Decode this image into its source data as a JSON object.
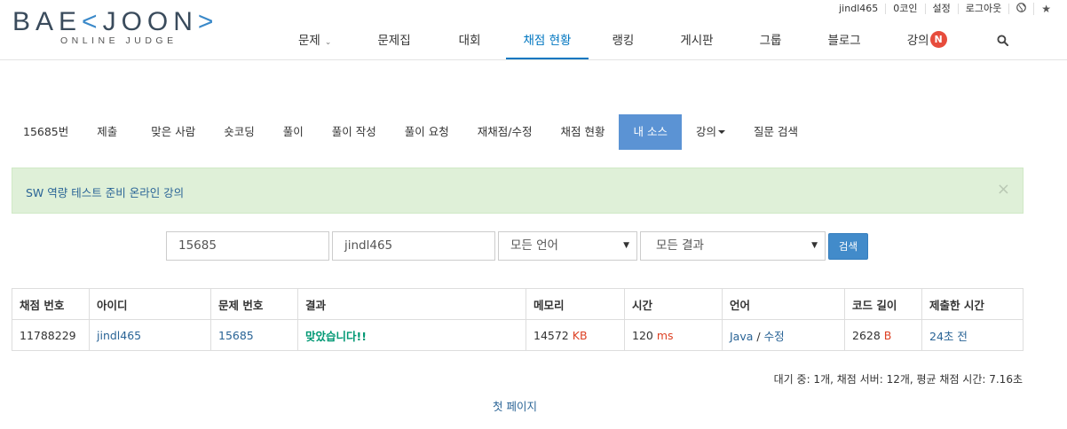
{
  "logo": {
    "sub": "ONLINE JUDGE"
  },
  "topbar": {
    "user": "jindl465",
    "coins": "0코인",
    "settings": "설정",
    "logout": "로그아웃"
  },
  "nav": {
    "items": [
      "문제",
      "문제집",
      "대회",
      "채점 현황",
      "랭킹",
      "게시판",
      "그룹",
      "블로그",
      "강의"
    ],
    "badge": "N"
  },
  "subnav": {
    "items": [
      "15685번",
      "제출",
      "맞은 사람",
      "숏코딩",
      "풀이",
      "풀이 작성",
      "풀이 요청",
      "재채점/수정",
      "채점 현황",
      "내 소스",
      "강의",
      "질문 검색"
    ]
  },
  "alert": {
    "text": "SW 역량 테스트 준비 온라인 강의",
    "close": "×"
  },
  "search": {
    "problem": "15685",
    "user": "jindl465",
    "language": "모든 언어",
    "result": "모든 결과",
    "button": "검색"
  },
  "table": {
    "headers": [
      "채점 번호",
      "아이디",
      "문제 번호",
      "결과",
      "메모리",
      "시간",
      "언어",
      "코드 길이",
      "제출한 시간"
    ],
    "row": {
      "id": "11788229",
      "user": "jindl465",
      "problem": "15685",
      "result": "맞았습니다!!",
      "memory": "14572",
      "memory_unit": "KB",
      "time": "120",
      "time_unit": "ms",
      "language": "Java",
      "sep": " / ",
      "edit": "수정",
      "length": "2628",
      "length_unit": "B",
      "submitted": "24초 전"
    }
  },
  "stats": "대기 중: 1개, 채점 서버: 12개, 평균 채점 시간: 7.16초",
  "pager": "첫 페이지"
}
